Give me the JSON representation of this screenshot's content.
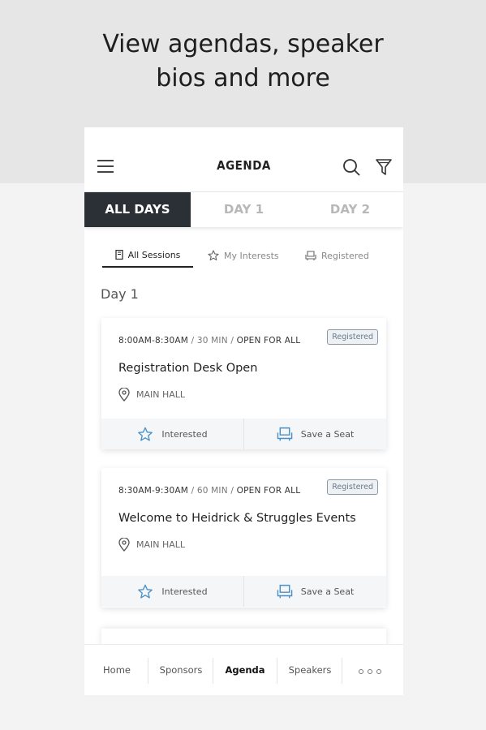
{
  "headline": {
    "line1": "View agendas, speaker",
    "line2": "bios and more"
  },
  "app": {
    "title": "AGENDA"
  },
  "icons": {
    "menu": "hamburger-menu-icon",
    "search": "search-icon",
    "filter": "filter-icon"
  },
  "day_tabs": [
    {
      "label": "ALL DAYS",
      "active": true
    },
    {
      "label": "DAY 1",
      "active": false
    },
    {
      "label": "DAY 2",
      "active": false
    }
  ],
  "session_filters": [
    {
      "label": "All Sessions",
      "icon": "book-icon",
      "active": true
    },
    {
      "label": "My Interests",
      "icon": "star-icon",
      "active": false
    },
    {
      "label": "Registered",
      "icon": "seat-icon",
      "active": false
    }
  ],
  "section_title": "Day 1",
  "sessions": [
    {
      "time": "8:00AM-8:30AM",
      "duration": "30 MIN",
      "access": "OPEN FOR ALL",
      "badge": "Registered",
      "title": "Registration Desk Open",
      "location": "MAIN HALL",
      "actions": {
        "interested": "Interested",
        "save": "Save a Seat"
      }
    },
    {
      "time": "8:30AM-9:30AM",
      "duration": "60 MIN",
      "access": "OPEN FOR ALL",
      "badge": "Registered",
      "title": "Welcome to Heidrick & Struggles Events",
      "location": "MAIN HALL",
      "actions": {
        "interested": "Interested",
        "save": "Save a Seat"
      }
    }
  ],
  "bottom_nav": [
    {
      "label": "Home",
      "active": false
    },
    {
      "label": "Sponsors",
      "active": false
    },
    {
      "label": "Agenda",
      "active": true
    },
    {
      "label": "Speakers",
      "active": false
    }
  ],
  "colors": {
    "active_tab_bg": "#2b3037",
    "accent_icon": "#4a90c8"
  }
}
